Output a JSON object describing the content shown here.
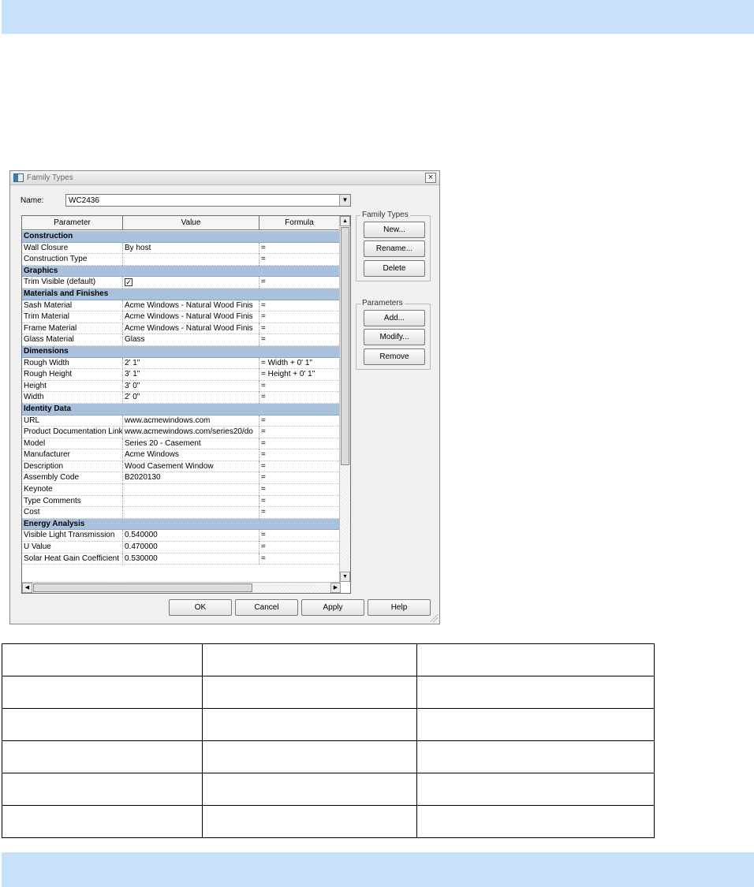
{
  "dialog": {
    "title": "Family Types",
    "close_glyph": "×",
    "name_label": "Name:",
    "name_value": "WC2436",
    "headers": {
      "parameter": "Parameter",
      "value": "Value",
      "formula": "Formula"
    },
    "groups": [
      {
        "title": "Construction",
        "rows": [
          {
            "param": "Wall Closure",
            "value": "By host",
            "formula": "="
          },
          {
            "param": "Construction Type",
            "value": "",
            "formula": "="
          }
        ]
      },
      {
        "title": "Graphics",
        "rows": [
          {
            "param": "Trim Visible (default)",
            "value": "",
            "checkbox": true,
            "checked": true,
            "formula": "="
          }
        ]
      },
      {
        "title": "Materials and Finishes",
        "rows": [
          {
            "param": "Sash Material",
            "value": "Acme Windows - Natural Wood Finis",
            "formula": "="
          },
          {
            "param": "Trim Material",
            "value": "Acme Windows - Natural Wood Finis",
            "formula": "="
          },
          {
            "param": "Frame Material",
            "value": "Acme Windows - Natural Wood Finis",
            "formula": "="
          },
          {
            "param": "Glass Material",
            "value": "Glass",
            "formula": "="
          }
        ]
      },
      {
        "title": "Dimensions",
        "rows": [
          {
            "param": "Rough Width",
            "value": "2' 1\"",
            "formula": "= Width + 0' 1\""
          },
          {
            "param": "Rough Height",
            "value": "3' 1\"",
            "formula": "= Height + 0' 1\""
          },
          {
            "param": "Height",
            "value": "3' 0\"",
            "formula": "="
          },
          {
            "param": "Width",
            "value": "2' 0\"",
            "formula": "="
          }
        ]
      },
      {
        "title": "Identity Data",
        "rows": [
          {
            "param": "URL",
            "value": "www.acmewindows.com",
            "formula": "="
          },
          {
            "param": "Product Documentation Link",
            "value": "www.acmewindows.com/series20/do",
            "formula": "="
          },
          {
            "param": "Model",
            "value": "Series 20 - Casement",
            "formula": "="
          },
          {
            "param": "Manufacturer",
            "value": "Acme Windows",
            "formula": "="
          },
          {
            "param": "Description",
            "value": "Wood Casement Window",
            "formula": "="
          },
          {
            "param": "Assembly Code",
            "value": "B2020130",
            "formula": "="
          },
          {
            "param": "Keynote",
            "value": "",
            "formula": "="
          },
          {
            "param": "Type Comments",
            "value": "",
            "formula": "="
          },
          {
            "param": "Cost",
            "value": "",
            "formula": "="
          }
        ]
      },
      {
        "title": "Energy Analysis",
        "rows": [
          {
            "param": "Visible Light Transmission",
            "value": "0.540000",
            "formula": "="
          },
          {
            "param": "U Value",
            "value": "0.470000",
            "formula": "="
          },
          {
            "param": "Solar Heat Gain Coefficient",
            "value": "0.530000",
            "formula": "="
          }
        ]
      }
    ],
    "family_types": {
      "legend": "Family Types",
      "new": "New...",
      "rename": "Rename...",
      "delete": "Delete"
    },
    "parameters": {
      "legend": "Parameters",
      "add": "Add...",
      "modify": "Modify...",
      "remove": "Remove"
    },
    "footer": {
      "ok": "OK",
      "cancel": "Cancel",
      "apply": "Apply",
      "help": "Help"
    },
    "glyphs": {
      "check": "✓",
      "dropdown": "▼",
      "up": "▲",
      "down": "▼",
      "left": "◀",
      "right": "▶"
    }
  },
  "blank_table": {
    "rows": 6,
    "cols": 3
  },
  "colors": {
    "band": "#c6e0f8",
    "section_header": "#a9c1dc"
  }
}
